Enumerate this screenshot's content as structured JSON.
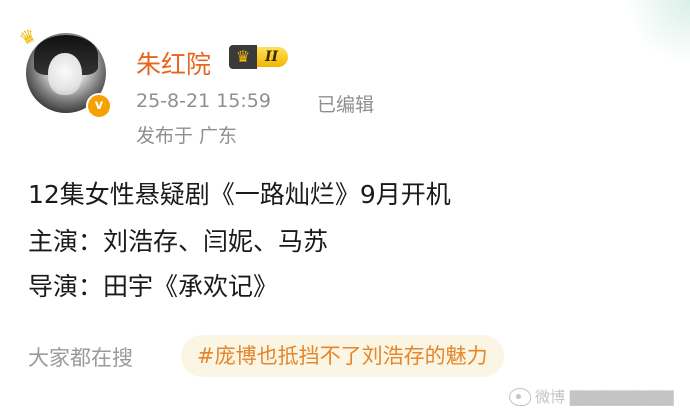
{
  "post": {
    "author": {
      "name": "朱红院",
      "level": "II",
      "verified_badge": "v",
      "icons": [
        "crown-icon",
        "verified-badge-icon",
        "level-crown-icon"
      ]
    },
    "timestamp": "25-8-21 15:59",
    "edited_label": "已编辑",
    "location": "发布于 广东",
    "content": {
      "line1": "12集女性悬疑剧《一路灿烂》9月开机",
      "line2": "主演：刘浩存、闫妮、马苏",
      "line3": "导演：田宇《承欢记》"
    }
  },
  "search": {
    "label": "大家都在搜",
    "hot_tag": "#庞博也抵挡不了刘浩存的魅力"
  },
  "watermark": {
    "text": "微博 ▇▇▇▇▇▇▇▇▇"
  },
  "colors": {
    "username": "#e9651f",
    "meta": "#8f8f8f",
    "tag_text": "#e4862b",
    "tag_bg": "#fbf6e4",
    "verified": "#f6a100"
  }
}
